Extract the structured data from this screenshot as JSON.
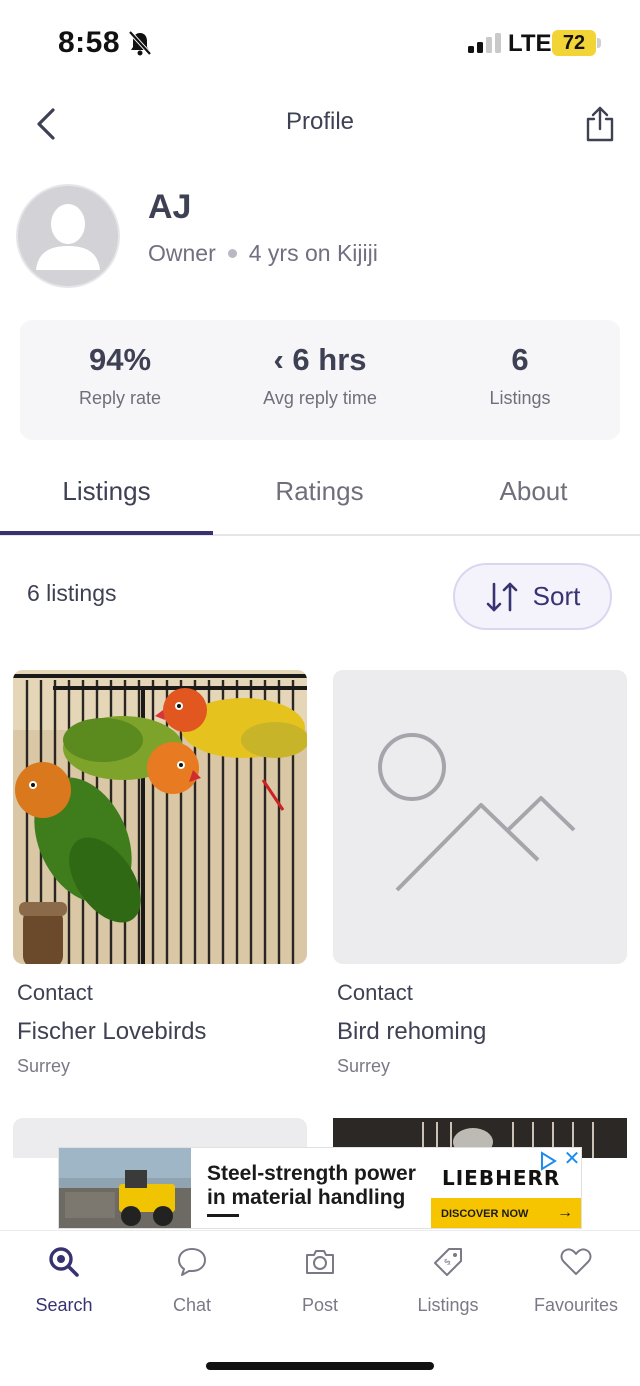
{
  "status": {
    "time": "8:58",
    "network": "LTE",
    "battery": "72"
  },
  "header": {
    "title": "Profile"
  },
  "profile": {
    "name": "AJ",
    "role": "Owner",
    "tenure": "4 yrs on Kijiji"
  },
  "stats": [
    {
      "value": "94%",
      "label": "Reply rate"
    },
    {
      "value": "‹ 6 hrs",
      "label": "Avg reply time"
    },
    {
      "value": "6",
      "label": "Listings"
    }
  ],
  "tabs": [
    {
      "label": "Listings",
      "active": true
    },
    {
      "label": "Ratings",
      "active": false
    },
    {
      "label": "About",
      "active": false
    }
  ],
  "listings_header": {
    "count": "6 listings",
    "sort_label": "Sort"
  },
  "listings": [
    {
      "price": "Contact",
      "title": "Fischer Lovebirds",
      "location": "Surrey",
      "image": "lovebirds-photo"
    },
    {
      "price": "Contact",
      "title": "Bird rehoming",
      "location": "Surrey",
      "image": "placeholder-image"
    }
  ],
  "ad": {
    "headline_line1": "Steel-strength power",
    "headline_line2": "in material handling",
    "brand": "LIEBHERR",
    "cta": "DISCOVER NOW"
  },
  "bottom_nav": [
    {
      "label": "Search",
      "icon": "search-icon",
      "active": true
    },
    {
      "label": "Chat",
      "icon": "chat-bubble-icon",
      "active": false
    },
    {
      "label": "Post",
      "icon": "camera-icon",
      "active": false
    },
    {
      "label": "Listings",
      "icon": "tag-icon",
      "active": false
    },
    {
      "label": "Favourites",
      "icon": "heart-icon",
      "active": false
    }
  ],
  "colors": {
    "accent": "#373373",
    "battery": "#f3d436",
    "ad_cta": "#f7c500"
  }
}
